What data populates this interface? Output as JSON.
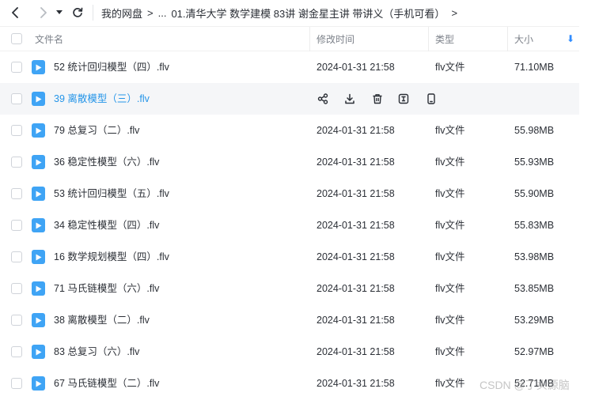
{
  "nav": {
    "back_icon": "chevron-left-icon",
    "forward_icon": "chevron-right-icon",
    "history_icon": "caret-down-icon",
    "refresh_icon": "refresh-icon"
  },
  "breadcrumb": {
    "root": "我的网盘",
    "separator": ">",
    "ellipsis": "...",
    "current": "01.清华大学 数学建模 83讲 谢金星主讲 带讲义（手机可看）",
    "end_separator": ">"
  },
  "columns": {
    "name": "文件名",
    "modified": "修改时间",
    "type": "类型",
    "size": "大小",
    "sort_icon": "arrow-down-icon",
    "sort_color": "#2f8cff"
  },
  "colors": {
    "file_icon": "#3fa4f5",
    "hover_row": "#f5f6f8",
    "hover_text": "#2595e8"
  },
  "row_actions": [
    "share-icon",
    "download-icon",
    "trash-icon",
    "rename-icon",
    "mobile-icon"
  ],
  "files": [
    {
      "name": "52 统计回归模型（四）.flv",
      "date": "2024-01-31 21:58",
      "type": "flv文件",
      "size": "71.10MB",
      "hover": false
    },
    {
      "name": "39 离散模型（三）.flv",
      "date": "",
      "type": "",
      "size": "",
      "hover": true
    },
    {
      "name": "79 总复习（二）.flv",
      "date": "2024-01-31 21:58",
      "type": "flv文件",
      "size": "55.98MB",
      "hover": false
    },
    {
      "name": "36 稳定性模型（六）.flv",
      "date": "2024-01-31 21:58",
      "type": "flv文件",
      "size": "55.93MB",
      "hover": false
    },
    {
      "name": "53 统计回归模型（五）.flv",
      "date": "2024-01-31 21:58",
      "type": "flv文件",
      "size": "55.90MB",
      "hover": false
    },
    {
      "name": "34 稳定性模型（四）.flv",
      "date": "2024-01-31 21:58",
      "type": "flv文件",
      "size": "55.83MB",
      "hover": false
    },
    {
      "name": "16 数学规划模型（四）.flv",
      "date": "2024-01-31 21:58",
      "type": "flv文件",
      "size": "53.98MB",
      "hover": false
    },
    {
      "name": "71 马氏链模型（六）.flv",
      "date": "2024-01-31 21:58",
      "type": "flv文件",
      "size": "53.85MB",
      "hover": false
    },
    {
      "name": "38 离散模型（二）.flv",
      "date": "2024-01-31 21:58",
      "type": "flv文件",
      "size": "53.29MB",
      "hover": false
    },
    {
      "name": "83 总复习（六）.flv",
      "date": "2024-01-31 21:58",
      "type": "flv文件",
      "size": "52.97MB",
      "hover": false
    },
    {
      "name": "67 马氏链模型（二）.flv",
      "date": "2024-01-31 21:58",
      "type": "flv文件",
      "size": "52.71MB",
      "hover": false
    }
  ],
  "watermark": "CSDN @丁头源脑"
}
